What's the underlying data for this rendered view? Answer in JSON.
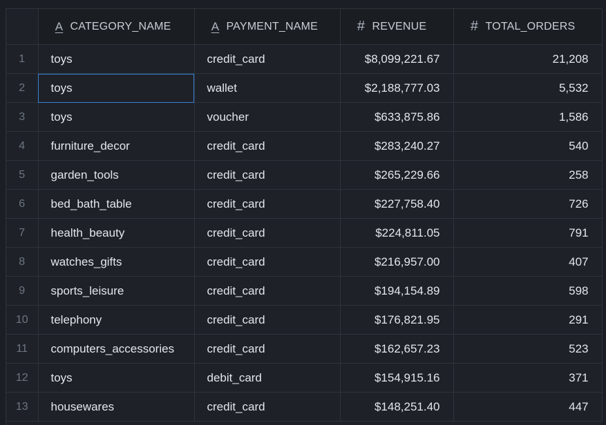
{
  "columns": [
    {
      "label": "CATEGORY_NAME",
      "type_icon": "A",
      "type": "text"
    },
    {
      "label": "PAYMENT_NAME",
      "type_icon": "A",
      "type": "text"
    },
    {
      "label": "REVENUE",
      "type_icon": "#",
      "type": "number"
    },
    {
      "label": "TOTAL_ORDERS",
      "type_icon": "#",
      "type": "number"
    }
  ],
  "rows": [
    {
      "index": "1",
      "category_name": "toys",
      "payment_name": "credit_card",
      "revenue": "$8,099,221.67",
      "total_orders": "21,208"
    },
    {
      "index": "2",
      "category_name": "toys",
      "payment_name": "wallet",
      "revenue": "$2,188,777.03",
      "total_orders": "5,532"
    },
    {
      "index": "3",
      "category_name": "toys",
      "payment_name": "voucher",
      "revenue": "$633,875.86",
      "total_orders": "1,586"
    },
    {
      "index": "4",
      "category_name": "furniture_decor",
      "payment_name": "credit_card",
      "revenue": "$283,240.27",
      "total_orders": "540"
    },
    {
      "index": "5",
      "category_name": "garden_tools",
      "payment_name": "credit_card",
      "revenue": "$265,229.66",
      "total_orders": "258"
    },
    {
      "index": "6",
      "category_name": "bed_bath_table",
      "payment_name": "credit_card",
      "revenue": "$227,758.40",
      "total_orders": "726"
    },
    {
      "index": "7",
      "category_name": "health_beauty",
      "payment_name": "credit_card",
      "revenue": "$224,811.05",
      "total_orders": "791"
    },
    {
      "index": "8",
      "category_name": "watches_gifts",
      "payment_name": "credit_card",
      "revenue": "$216,957.00",
      "total_orders": "407"
    },
    {
      "index": "9",
      "category_name": "sports_leisure",
      "payment_name": "credit_card",
      "revenue": "$194,154.89",
      "total_orders": "598"
    },
    {
      "index": "10",
      "category_name": "telephony",
      "payment_name": "credit_card",
      "revenue": "$176,821.95",
      "total_orders": "291"
    },
    {
      "index": "11",
      "category_name": "computers_accessories",
      "payment_name": "credit_card",
      "revenue": "$162,657.23",
      "total_orders": "523"
    },
    {
      "index": "12",
      "category_name": "toys",
      "payment_name": "debit_card",
      "revenue": "$154,915.16",
      "total_orders": "371"
    },
    {
      "index": "13",
      "category_name": "housewares",
      "payment_name": "credit_card",
      "revenue": "$148,251.40",
      "total_orders": "447"
    }
  ],
  "selected_cell": {
    "row": 1,
    "column": "category_name"
  },
  "colors": {
    "background": "#1b1f25",
    "grid_line": "#2e333b",
    "header_bg": "#1a1e23",
    "text": "#e3e6eb",
    "row_index": "#6e7580",
    "selection": "#3b7fd6"
  }
}
